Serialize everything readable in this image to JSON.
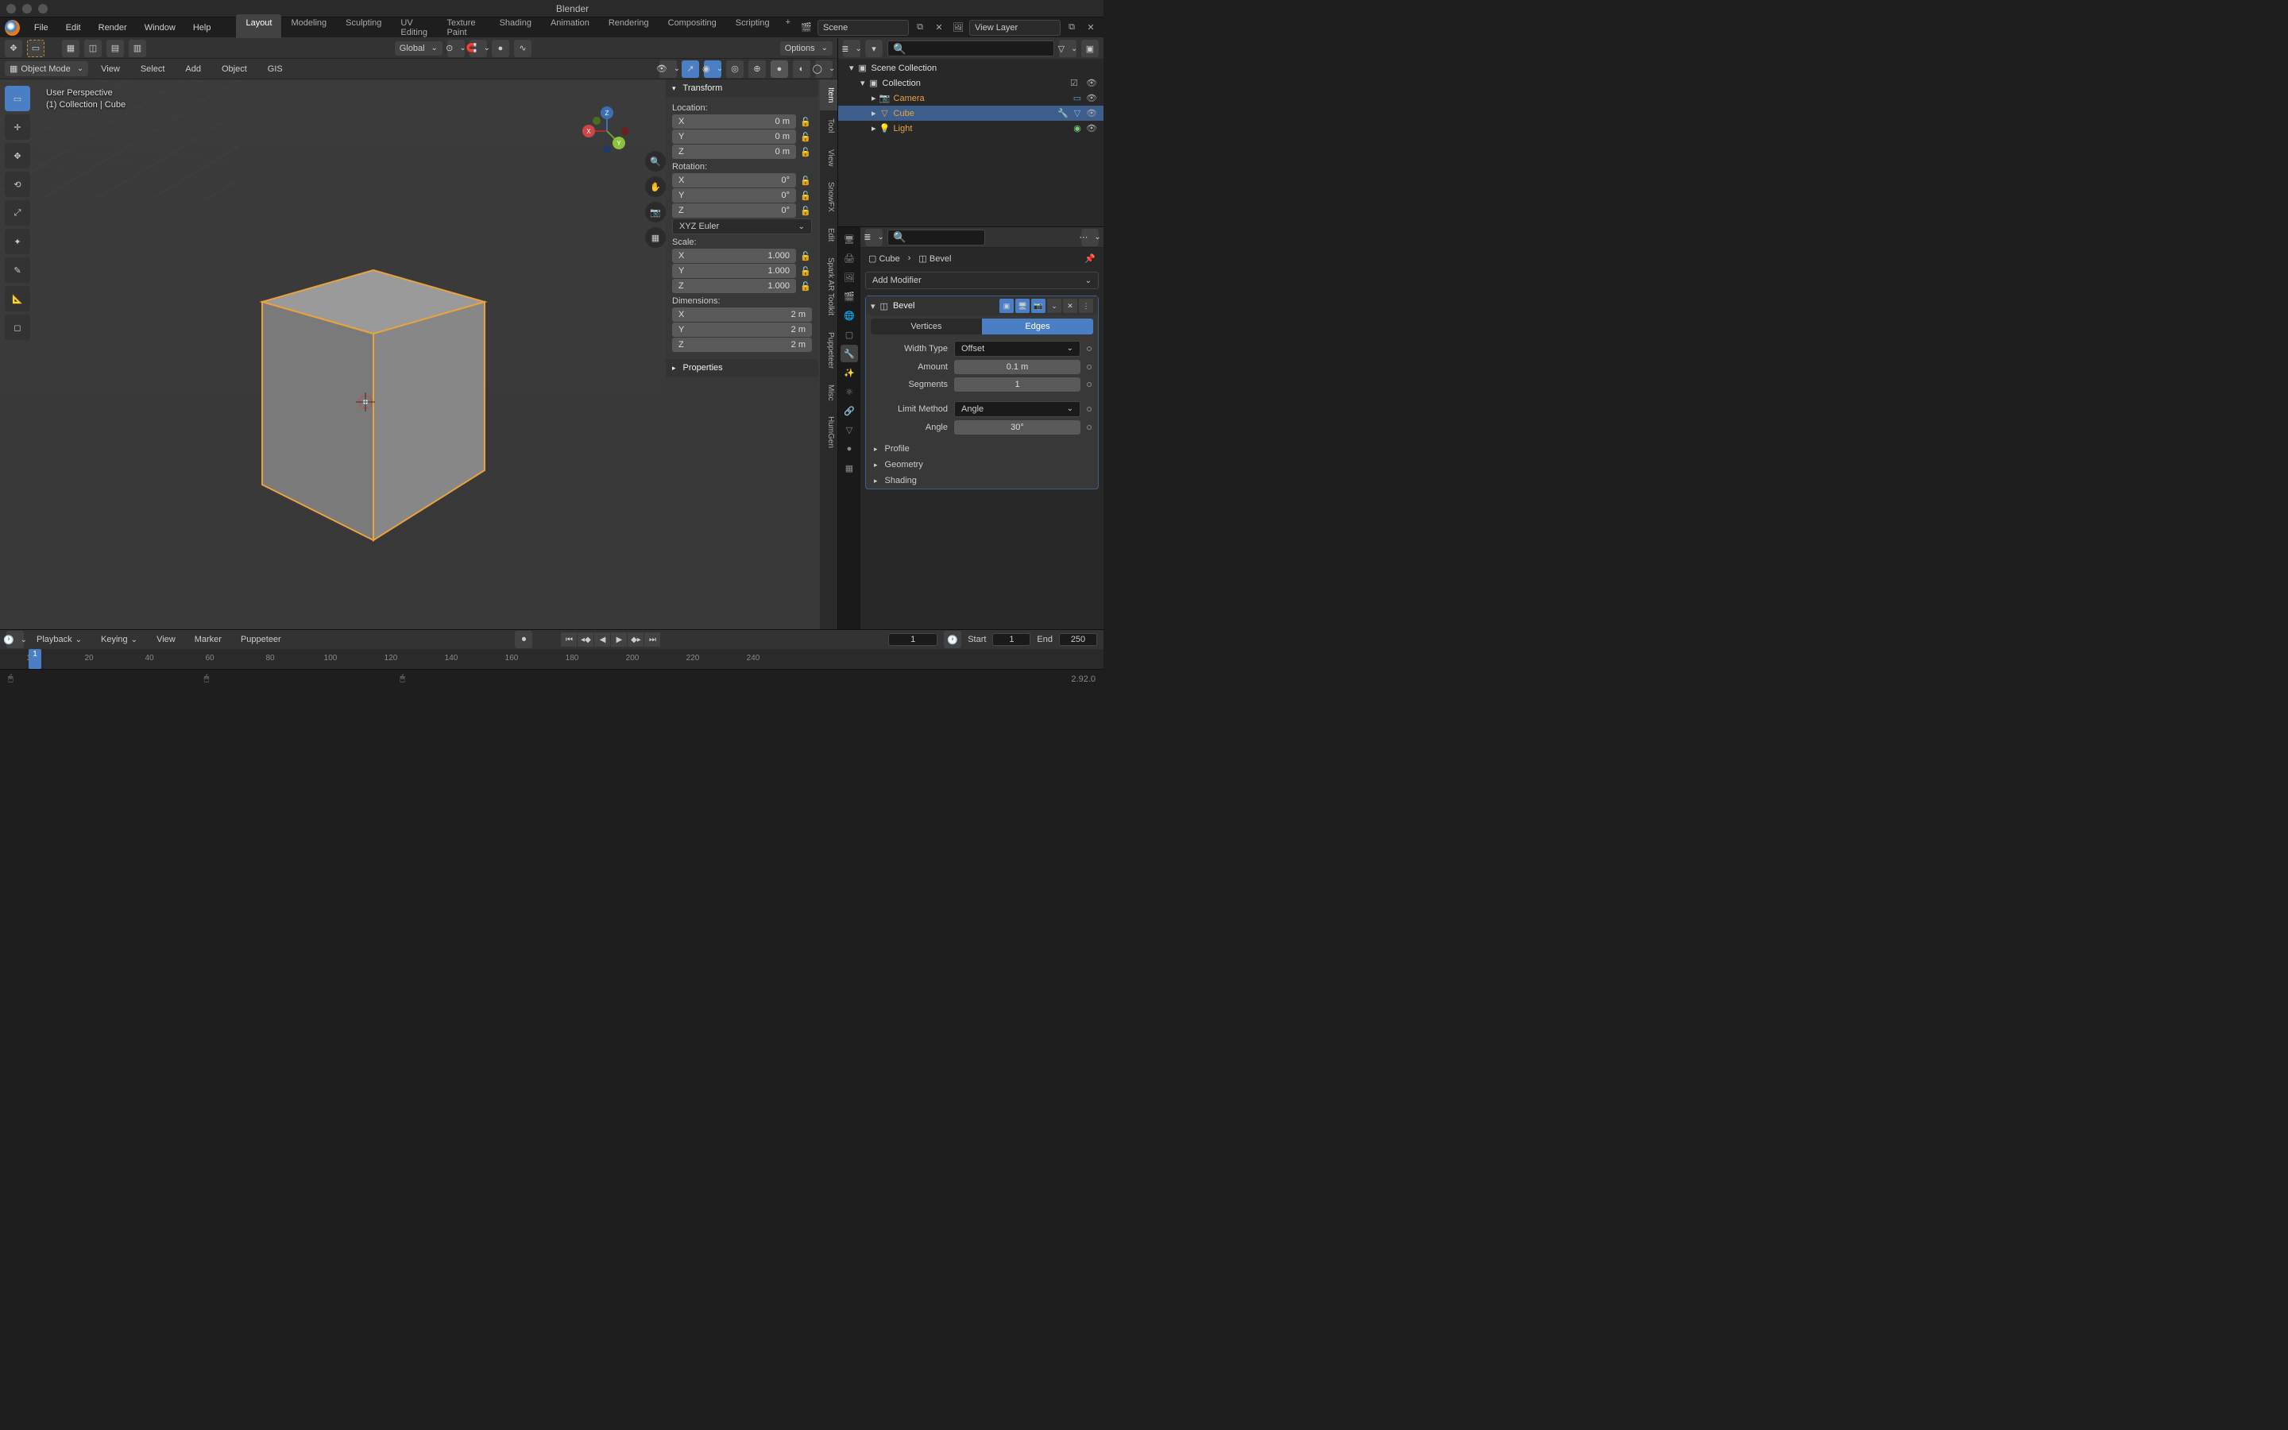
{
  "app": {
    "title": "Blender",
    "version": "2.92.0"
  },
  "menu": [
    "File",
    "Edit",
    "Render",
    "Window",
    "Help"
  ],
  "workspaces": {
    "active": "Layout",
    "tabs": [
      "Layout",
      "Modeling",
      "Sculpting",
      "UV Editing",
      "Texture Paint",
      "Shading",
      "Animation",
      "Rendering",
      "Compositing",
      "Scripting"
    ]
  },
  "scene": {
    "name": "Scene",
    "view_layer": "View Layer"
  },
  "viewport": {
    "mode": "Object Mode",
    "header_menus": [
      "View",
      "Select",
      "Add",
      "Object",
      "GIS"
    ],
    "orientation": "Global",
    "options": "Options",
    "persp": "User Perspective",
    "context": "(1) Collection | Cube"
  },
  "tools": [
    "select-box",
    "cursor",
    "move",
    "rotate",
    "scale",
    "transform",
    "annotate",
    "measure",
    "add-cube"
  ],
  "n_panel": {
    "header": "Transform",
    "location_label": "Location:",
    "location": {
      "x": "0 m",
      "y": "0 m",
      "z": "0 m"
    },
    "rotation_label": "Rotation:",
    "rotation": {
      "x": "0°",
      "y": "0°",
      "z": "0°"
    },
    "rotation_mode": "XYZ Euler",
    "scale_label": "Scale:",
    "scale": {
      "x": "1.000",
      "y": "1.000",
      "z": "1.000"
    },
    "dimensions_label": "Dimensions:",
    "dimensions": {
      "x": "2 m",
      "y": "2 m",
      "z": "2 m"
    },
    "properties_header": "Properties",
    "tabs": [
      "Item",
      "Tool",
      "View",
      "SnowFX",
      "Edit",
      "Spark AR Toolkit",
      "Puppeteer",
      "Misc",
      "HumGen"
    ]
  },
  "outliner": {
    "root": "Scene Collection",
    "collection": "Collection",
    "items": [
      {
        "name": "Camera",
        "type": "camera"
      },
      {
        "name": "Cube",
        "type": "mesh",
        "selected": true
      },
      {
        "name": "Light",
        "type": "light"
      }
    ]
  },
  "properties": {
    "breadcrumb_obj": "Cube",
    "breadcrumb_mod": "Bevel",
    "add_modifier": "Add Modifier",
    "bevel": {
      "name": "Bevel",
      "tabs": {
        "vertices": "Vertices",
        "edges": "Edges",
        "active": "edges"
      },
      "width_type_label": "Width Type",
      "width_type": "Offset",
      "amount_label": "Amount",
      "amount": "0.1 m",
      "segments_label": "Segments",
      "segments": "1",
      "limit_method_label": "Limit Method",
      "limit_method": "Angle",
      "angle_label": "Angle",
      "angle": "30°",
      "sections": [
        "Profile",
        "Geometry",
        "Shading"
      ]
    }
  },
  "timeline": {
    "menus": [
      "Playback",
      "Keying",
      "View",
      "Marker",
      "Puppeteer"
    ],
    "current": "1",
    "start_label": "Start",
    "start": "1",
    "end_label": "End",
    "end": "250",
    "ticks": [
      1,
      20,
      40,
      60,
      80,
      100,
      120,
      140,
      160,
      180,
      200,
      220,
      240
    ]
  }
}
